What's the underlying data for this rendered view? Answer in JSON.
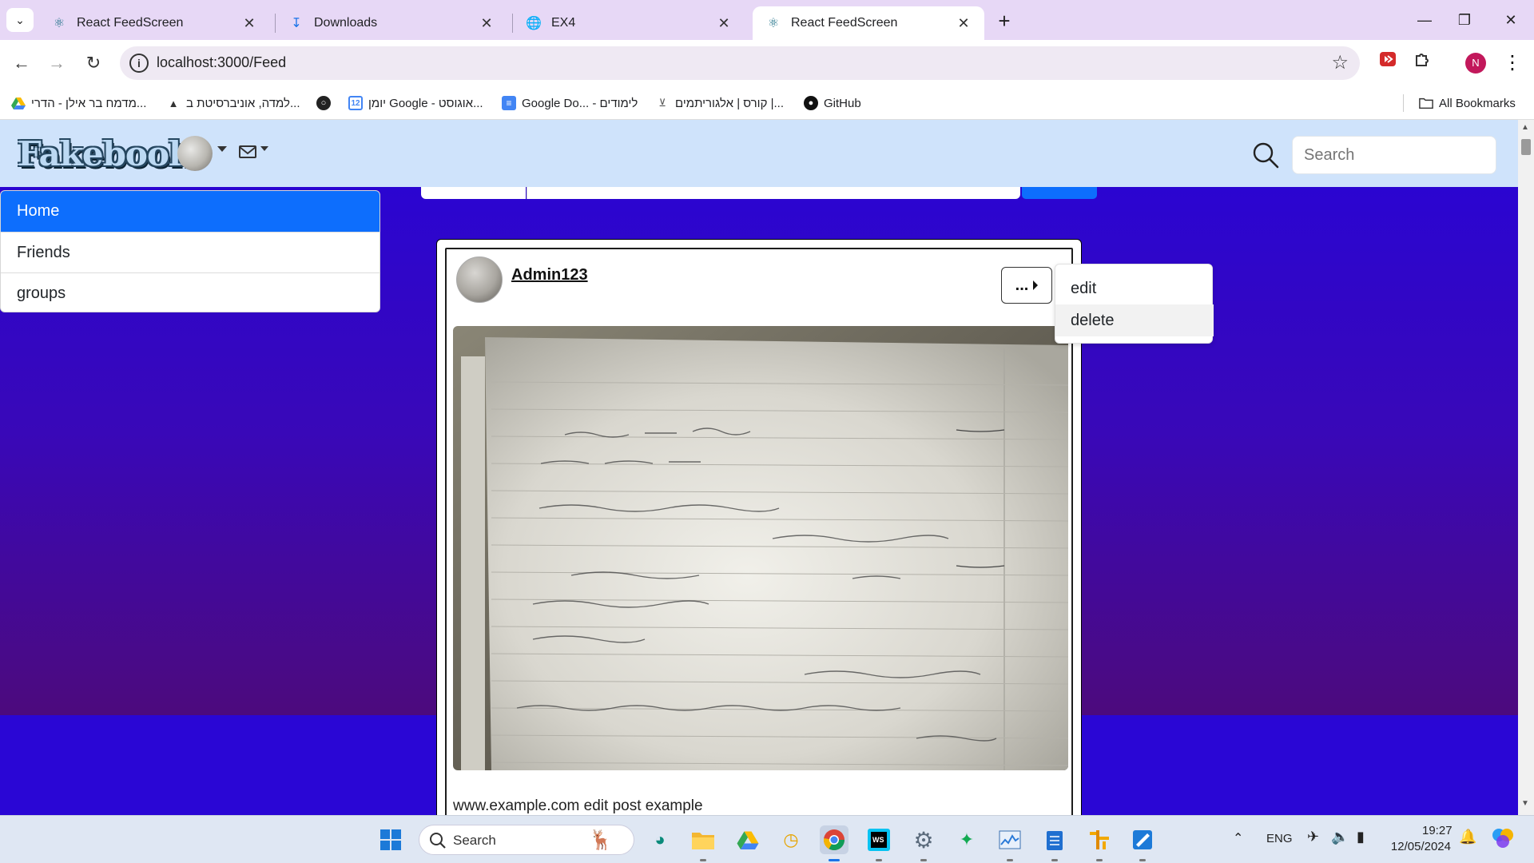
{
  "browser": {
    "tabs": [
      {
        "title": "React FeedScreen",
        "active": false
      },
      {
        "title": "Downloads",
        "active": false
      },
      {
        "title": "EX4",
        "active": false
      },
      {
        "title": "React FeedScreen",
        "active": true
      }
    ],
    "url": "localhost:3000/Feed",
    "profile_initial": "N",
    "bookmarks": [
      {
        "label": "מדמח בר אילן - הדרי...",
        "icon": "google-drive-icon"
      },
      {
        "label": "למדה, אוניברסיטת ב...",
        "icon": "moodle-icon"
      },
      {
        "label": "",
        "icon": "globe-icon"
      },
      {
        "label": "יומן Google - אוגוסט...",
        "icon": "google-calendar-icon"
      },
      {
        "label": "Google Do... - לימודים",
        "icon": "google-docs-icon"
      },
      {
        "label": "קורס | אלגוריתמים |...",
        "icon": "course-icon"
      },
      {
        "label": "GitHub",
        "icon": "github-icon"
      }
    ],
    "all_bookmarks": "All Bookmarks"
  },
  "app": {
    "logo": "Fakebook",
    "search_placeholder": "Search",
    "sidebar": [
      {
        "label": "Home",
        "active": true
      },
      {
        "label": "Friends",
        "active": false
      },
      {
        "label": "groups",
        "active": false
      }
    ],
    "post": {
      "username": "Admin123",
      "menu_label": "...",
      "text": "www.example.com edit post example"
    },
    "post_menu": [
      "edit",
      "delete"
    ]
  },
  "taskbar": {
    "search_label": "Search",
    "language": "ENG",
    "time": "19:27",
    "date": "12/05/2024"
  },
  "colors": {
    "accent": "#0d6efd",
    "navbar": "#cfe3fb",
    "background": "#2704d8"
  }
}
